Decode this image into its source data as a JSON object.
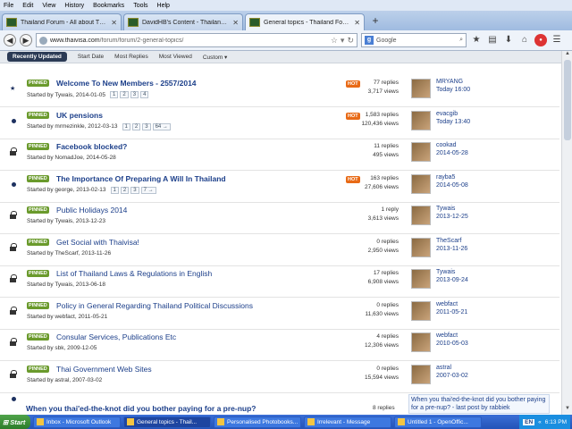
{
  "menu": [
    "File",
    "Edit",
    "View",
    "History",
    "Bookmarks",
    "Tools",
    "Help"
  ],
  "tabs": [
    {
      "label": "Thailand Forum - All about Th...",
      "active": false
    },
    {
      "label": "DavidHB's Content - Thailand ...",
      "active": false
    },
    {
      "label": "General topics - Thailand Forum",
      "active": true
    }
  ],
  "nav": {
    "url_host": "www.thaivisa.com",
    "url_path": "/forum/forum/2-general-topics/",
    "search_placeholder": "Google"
  },
  "sortbar": {
    "active": "Recently Updated",
    "items": [
      "Start Date",
      "Most Replies",
      "Most Viewed",
      "Custom ▾"
    ]
  },
  "pinned_label": "PINNED",
  "hot_label": "HOT",
  "topics": [
    {
      "marker": "star",
      "title": "Welcome To New Members - 2557/2014",
      "bold": true,
      "starter": "Started by Tywais, 2014-01-05",
      "pages": [
        "1",
        "2",
        "3",
        "4"
      ],
      "hot": true,
      "replies": "77 replies",
      "views": "3,717 views",
      "last_user": "MRYANG",
      "last_date": "Today 16:00"
    },
    {
      "marker": "dot",
      "title": "UK pensions",
      "bold": true,
      "starter": "Started by mrmezinkle, 2012-03-13",
      "pages": [
        "1",
        "2",
        "3",
        "64 →"
      ],
      "hot": true,
      "replies": "1,583 replies",
      "views": "120,436 views",
      "last_user": "evacgib",
      "last_date": "Today 13:40"
    },
    {
      "marker": "lock",
      "title": "Facebook blocked?",
      "bold": true,
      "starter": "Started by NomadJoe, 2014-05-28",
      "pages": [],
      "hot": false,
      "replies": "11 replies",
      "views": "495 views",
      "last_user": "cookad",
      "last_date": "2014-05-28"
    },
    {
      "marker": "dot",
      "title": "The Importance Of Preparing A Will In Thailand",
      "bold": true,
      "starter": "Started by george, 2013-02-13",
      "pages": [
        "1",
        "2",
        "3",
        "7 →"
      ],
      "hot": true,
      "replies": "163 replies",
      "views": "27,606 views",
      "last_user": "rayba5",
      "last_date": "2014-05-08"
    },
    {
      "marker": "lock",
      "title": "Public Holidays 2014",
      "bold": false,
      "starter": "Started by Tywais, 2013-12-23",
      "pages": [],
      "hot": false,
      "replies": "1 reply",
      "views": "3,613 views",
      "last_user": "Tywais",
      "last_date": "2013-12-25"
    },
    {
      "marker": "lock",
      "title": "Get Social with Thaivisa!",
      "bold": false,
      "starter": "Started by TheScarf, 2013-11-26",
      "pages": [],
      "hot": false,
      "replies": "0 replies",
      "views": "2,950 views",
      "last_user": "TheScarf",
      "last_date": "2013-11-26"
    },
    {
      "marker": "lock",
      "title": "List of Thailand Laws & Regulations in English",
      "bold": false,
      "starter": "Started by Tywais, 2013-06-18",
      "pages": [],
      "hot": false,
      "replies": "17 replies",
      "views": "6,908 views",
      "last_user": "Tywais",
      "last_date": "2013-09-24"
    },
    {
      "marker": "lock",
      "title": "Policy in General Regarding Thailand Political Discussions",
      "bold": false,
      "starter": "Started by webfact, 2011-05-21",
      "pages": [],
      "hot": false,
      "replies": "0 replies",
      "views": "11,630 views",
      "last_user": "webfact",
      "last_date": "2011-05-21"
    },
    {
      "marker": "lock",
      "title": "Consular Services, Publications Etc",
      "bold": false,
      "starter": "Started by sbk, 2009-12-05",
      "pages": [],
      "hot": false,
      "replies": "4 replies",
      "views": "12,306 views",
      "last_user": "webfact",
      "last_date": "2010-05-03"
    },
    {
      "marker": "lock",
      "title": "Thai Government Web Sites",
      "bold": false,
      "starter": "Started by astral, 2007-03-02",
      "pages": [],
      "hot": false,
      "replies": "0 replies",
      "views": "15,594 views",
      "last_user": "astral",
      "last_date": "2007-03-02"
    }
  ],
  "last_row": {
    "title": "When you thai'ed-the-knot did you bother paying for a pre-nup?",
    "replies": "8 replies",
    "preview": "When you thai'ed-the-knot did you bother paying for a pre-nup? - last post by rabbiek"
  },
  "taskbar": {
    "start": "Start",
    "tasks": [
      {
        "label": "Inbox - Microsoft Outlook",
        "active": false
      },
      {
        "label": "General topics - Thail...",
        "active": true
      },
      {
        "label": "Personalised Photobooks...",
        "active": false
      },
      {
        "label": "Irrelevant - Message",
        "active": false
      },
      {
        "label": "Untitled 1 - OpenOffic...",
        "active": false
      }
    ],
    "lang": "EN",
    "clock": "6:13 PM"
  }
}
